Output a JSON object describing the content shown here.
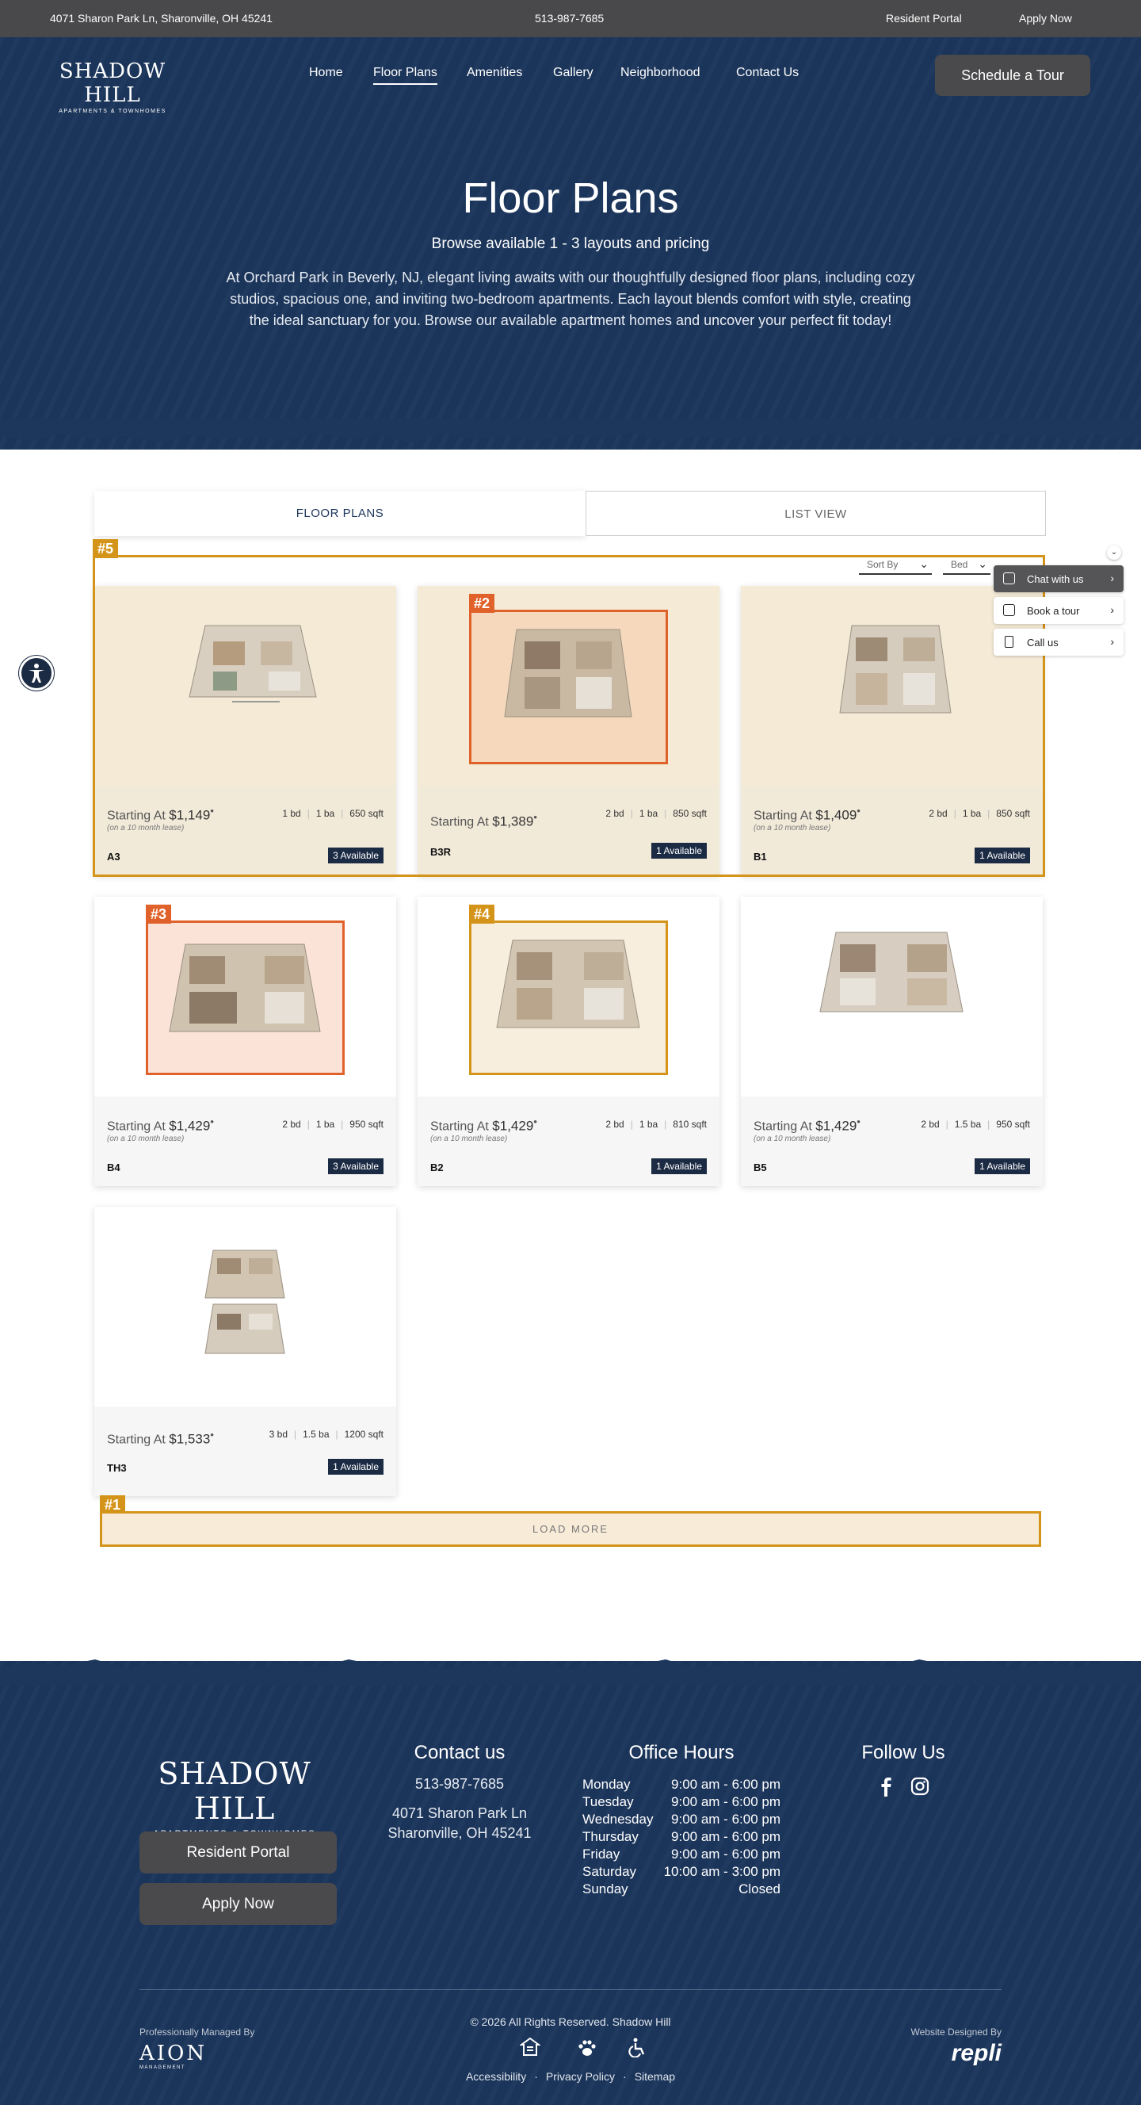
{
  "topbar": {
    "address": "4071 Sharon Park Ln, Sharonville, OH 45241",
    "phone": "513-987-7685",
    "resident_portal": "Resident Portal",
    "apply_now": "Apply Now"
  },
  "brand": {
    "name": "SHADOW HILL",
    "tagline": "APARTMENTS & TOWNHOMES"
  },
  "nav": {
    "items": [
      "Home",
      "Floor Plans",
      "Amenities",
      "Gallery",
      "Neighborhood",
      "Contact Us"
    ],
    "active": "Floor Plans",
    "cta": "Schedule a Tour"
  },
  "hero": {
    "title": "Floor Plans",
    "subtitle": "Browse available 1 - 3 layouts and pricing",
    "description": "At Orchard Park in Beverly, NJ, elegant living awaits with our thoughtfully designed floor plans, including cozy studios, spacious one, and inviting two-bedroom apartments. Each layout blends comfort with style, creating the ideal sanctuary for you. Browse our available apartment homes and uncover your perfect fit today!"
  },
  "tabs": {
    "floor_plans": "FLOOR PLANS",
    "list_view": "LIST VIEW"
  },
  "sort": {
    "label": "Sort By",
    "filter": "Bed"
  },
  "highlights": {
    "h1": "#1",
    "h2": "#2",
    "h3": "#3",
    "h4": "#4",
    "h5": "#5"
  },
  "colors": {
    "navy": "#1c365c",
    "gold": "#d4941a",
    "orange": "#e0622a",
    "charcoal": "#4a4a4c"
  },
  "chat": {
    "chat_label": "Chat with us",
    "book_label": "Book a tour",
    "call_label": "Call us",
    "arrow": "›",
    "collapse": "⌄"
  },
  "plans": [
    {
      "name": "A3",
      "prefix": "Starting At",
      "price": "$1,149",
      "lease": "(on a 10 month lease)",
      "bd": "1 bd",
      "ba": "1 ba",
      "sqft": "650 sqft",
      "available": "3 Available"
    },
    {
      "name": "B3R",
      "prefix": "Starting At",
      "price": "$1,389",
      "lease": "",
      "bd": "2 bd",
      "ba": "1 ba",
      "sqft": "850 sqft",
      "available": "1 Available"
    },
    {
      "name": "B1",
      "prefix": "Starting At",
      "price": "$1,409",
      "lease": "(on a 10 month lease)",
      "bd": "2 bd",
      "ba": "1 ba",
      "sqft": "850 sqft",
      "available": "1 Available"
    },
    {
      "name": "B4",
      "prefix": "Starting At",
      "price": "$1,429",
      "lease": "(on a 10 month lease)",
      "bd": "2 bd",
      "ba": "1 ba",
      "sqft": "950 sqft",
      "available": "3 Available"
    },
    {
      "name": "B2",
      "prefix": "Starting At",
      "price": "$1,429",
      "lease": "(on a 10 month lease)",
      "bd": "2 bd",
      "ba": "1 ba",
      "sqft": "810 sqft",
      "available": "1 Available"
    },
    {
      "name": "B5",
      "prefix": "Starting At",
      "price": "$1,429",
      "lease": "(on a 10 month lease)",
      "bd": "2 bd",
      "ba": "1.5 ba",
      "sqft": "950 sqft",
      "available": "1 Available"
    },
    {
      "name": "TH3",
      "prefix": "Starting At",
      "price": "$1,533",
      "lease": "",
      "bd": "3 bd",
      "ba": "1.5 ba",
      "sqft": "1200 sqft",
      "available": "1 Available"
    }
  ],
  "load_more": "LOAD MORE",
  "footer": {
    "contact_heading": "Contact us",
    "phone": "513-987-7685",
    "address_line1": "4071 Sharon Park Ln",
    "address_line2": "Sharonville, OH 45241",
    "hours_heading": "Office Hours",
    "hours": [
      {
        "day": "Monday",
        "time": "9:00 am - 6:00 pm"
      },
      {
        "day": "Tuesday",
        "time": "9:00 am - 6:00 pm"
      },
      {
        "day": "Wednesday",
        "time": "9:00 am - 6:00 pm"
      },
      {
        "day": "Thursday",
        "time": "9:00 am - 6:00 pm"
      },
      {
        "day": "Friday",
        "time": "9:00 am - 6:00 pm"
      },
      {
        "day": "Saturday",
        "time": "10:00 am - 3:00 pm"
      },
      {
        "day": "Sunday",
        "time": "Closed"
      }
    ],
    "follow_heading": "Follow Us",
    "resident_portal": "Resident Portal",
    "apply_now": "Apply Now",
    "managed_by": "Professionally Managed By",
    "managed_logo": "AION",
    "managed_logo_sub": "MANAGEMENT",
    "copyright": "© 2026 All Rights Reserved. Shadow Hill",
    "designed_by": "Website Designed By",
    "designer_logo": "repli",
    "links": [
      "Accessibility",
      "Privacy Policy",
      "Sitemap"
    ],
    "link_separator": "·"
  }
}
